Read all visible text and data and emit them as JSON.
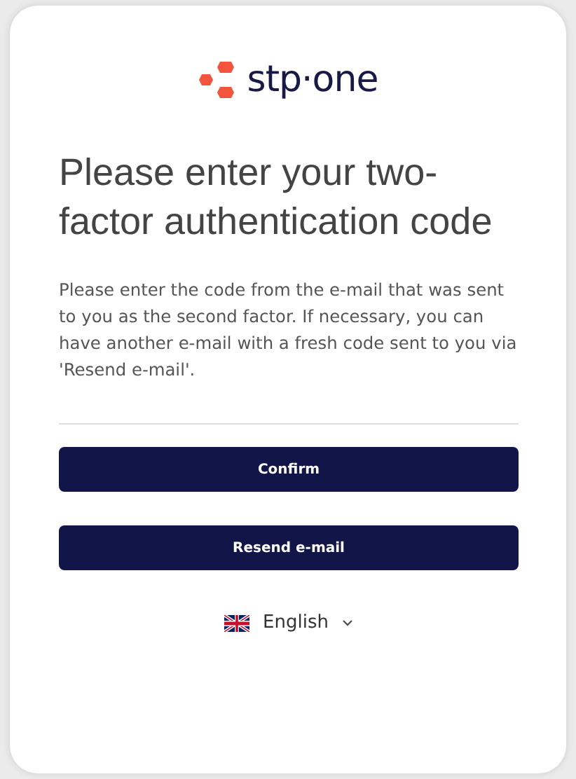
{
  "logo": {
    "text": "stp·one"
  },
  "title": "Please enter your two-factor authentication code",
  "description": "Please enter the code from the e-mail that was sent to you as the second factor. If necessary, you can have another e-mail with a fresh code sent to you via 'Resend e-mail'.",
  "buttons": [
    "Confirm",
    "Resend e-mail"
  ],
  "language": {
    "label": "English"
  }
}
